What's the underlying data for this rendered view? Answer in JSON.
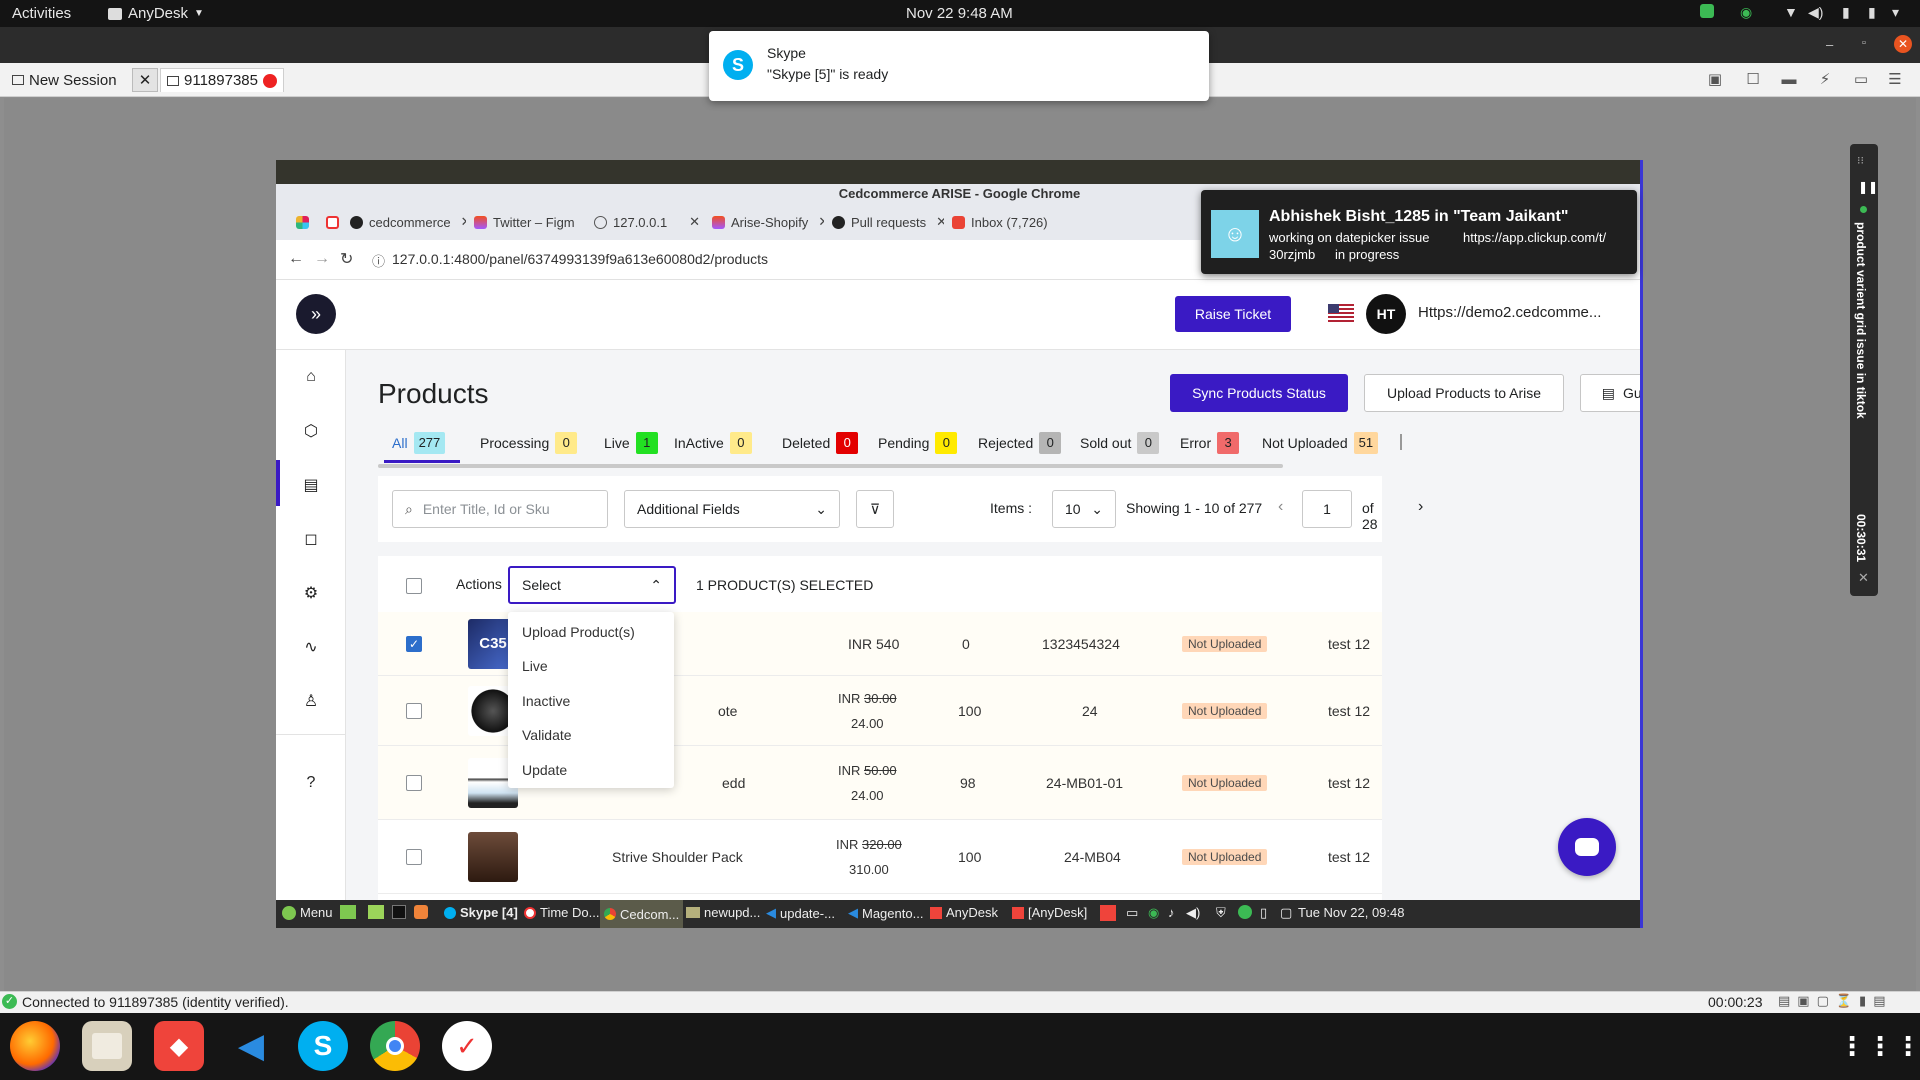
{
  "topbar": {
    "activities": "Activities",
    "app_name": "AnyDesk",
    "clock": "Nov 22  9:48 AM"
  },
  "anydesk": {
    "new_session": "New Session",
    "session_id": "911897385",
    "status": "Connected to 911897385 (identity verified).",
    "timer": "00:00:23"
  },
  "skype_notification": {
    "app": "Skype",
    "message": "\"Skype [5]\" is ready"
  },
  "chrome": {
    "window_title": "Cedcommerce ARISE - Google Chrome",
    "tabs": [
      {
        "label": "cedcommerce"
      },
      {
        "label": "Twitter – Figm"
      },
      {
        "label": "127.0.0.1"
      },
      {
        "label": "Arise-Shopify"
      },
      {
        "label": "Pull requests"
      },
      {
        "label": "Inbox (7,726)"
      }
    ],
    "url": "127.0.0.1:4800/panel/6374993139f9a613e60080d2/products"
  },
  "clickup": {
    "title": "Abhishek Bisht_1285 in \"Team Jaikant\"",
    "line1": "working on datepicker issue",
    "link": "https://app.clickup.com/t/",
    "line2": "30rzjmb",
    "status": "in progress"
  },
  "app_header": {
    "raise_ticket": "Raise Ticket",
    "avatar": "HT",
    "store_url": "Https://demo2.cedcomme..."
  },
  "products": {
    "title": "Products",
    "sync_button": "Sync Products Status",
    "upload_button": "Upload Products to Arise",
    "guide_button": "Guide",
    "status_tabs": [
      {
        "label": "All",
        "count": "277",
        "color": "#a4e8f2"
      },
      {
        "label": "Processing",
        "count": "0",
        "color": "#ffea8a"
      },
      {
        "label": "Live",
        "count": "1",
        "color": "#22e022"
      },
      {
        "label": "InActive",
        "count": "0",
        "color": "#ffea8a"
      },
      {
        "label": "Deleted",
        "count": "0",
        "color": "#e30000"
      },
      {
        "label": "Pending",
        "count": "0",
        "color": "#ffea00"
      },
      {
        "label": "Rejected",
        "count": "0",
        "color": "#b5b5b5"
      },
      {
        "label": "Sold out",
        "count": "0",
        "color": "#c9c9c9"
      },
      {
        "label": "Error",
        "count": "3",
        "color": "#f06a6a"
      },
      {
        "label": "Not Uploaded",
        "count": "51",
        "color": "#ffd79d"
      }
    ],
    "search_placeholder": "Enter Title, Id or Sku",
    "additional_fields": "Additional Fields",
    "items_label": "Items :",
    "items_value": "10",
    "showing": "Showing 1 - 10 of 277",
    "page": "1",
    "of_pages": "of  28",
    "actions_label": "Actions",
    "select_value": "Select",
    "selected_text": "1 PRODUCT(S) SELECTED",
    "dropdown_options": [
      "Upload Product(s)",
      "Live",
      "Inactive",
      "Validate",
      "Update"
    ],
    "rows": [
      {
        "title": "",
        "price": "INR   540",
        "price_old": "",
        "qty": "0",
        "sku": "1323454324",
        "status": "Not Uploaded",
        "template": "test 12",
        "checked": true
      },
      {
        "title": "ote",
        "price": "24.00",
        "price_old": "30.00",
        "qty": "100",
        "sku": "24",
        "status": "Not Uploaded",
        "template": "test 12",
        "checked": false
      },
      {
        "title": "edd",
        "price": "24.00",
        "price_old": "50.00",
        "qty": "98",
        "sku": "24-MB01-01",
        "status": "Not Uploaded",
        "template": "test 12",
        "checked": false
      },
      {
        "title": "Strive Shoulder Pack",
        "price": "310.00",
        "price_old": "320.00",
        "qty": "100",
        "sku": "24-MB04",
        "status": "Not Uploaded",
        "template": "test 12",
        "checked": false
      }
    ],
    "inr": "INR"
  },
  "remote_taskbar": {
    "menu": "Menu",
    "items": [
      "Skype [4]",
      "Time Do...",
      "Cedcom...",
      "newupd...",
      "update-...",
      "Magento...",
      "AnyDesk",
      "[AnyDesk]"
    ],
    "clock": "Tue Nov 22, 09:48"
  },
  "vertical_widget": {
    "label": "product varient grid issue in tiktok",
    "timer": "00:30:31"
  }
}
